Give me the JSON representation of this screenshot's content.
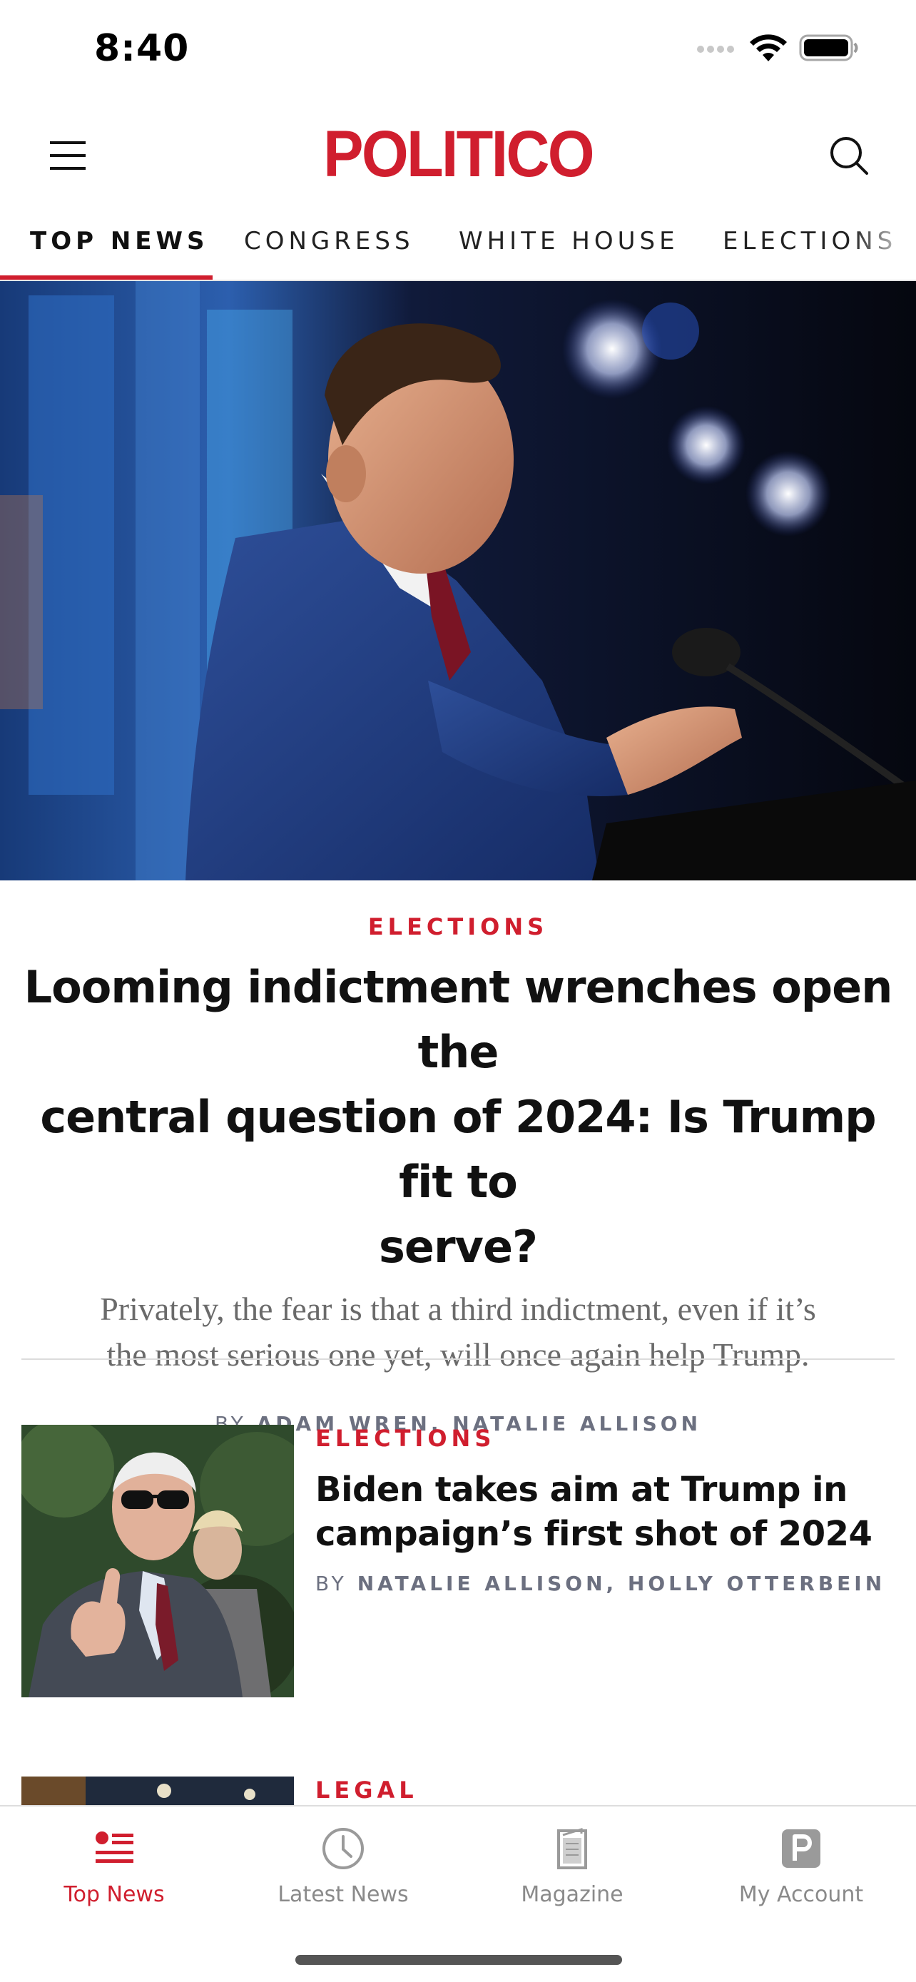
{
  "status_bar": {
    "time": "8:40",
    "icons": [
      "cellular-signal-icon",
      "wifi-icon",
      "battery-icon"
    ]
  },
  "header": {
    "logo": "POLITICO",
    "menu_icon": "hamburger-menu-icon",
    "search_icon": "search-icon"
  },
  "tabs": [
    {
      "label": "TOP NEWS",
      "active": true
    },
    {
      "label": "CONGRESS",
      "active": false
    },
    {
      "label": "WHITE HOUSE",
      "active": false
    },
    {
      "label": "ELECTIONS",
      "active": false
    }
  ],
  "hero": {
    "kicker": "ELECTIONS",
    "headline_lines": [
      "Looming indictment wrenches open the",
      "central question of 2024: Is Trump fit to",
      "serve?"
    ],
    "dek_lines": [
      "Privately, the fear is that a third indictment, even if it’s",
      "the most serious one yet, will once again help Trump."
    ],
    "byline_prefix": "BY",
    "byline_names": "ADAM WREN, NATALIE ALLISON"
  },
  "stories": [
    {
      "kicker": "ELECTIONS",
      "headline_lines": [
        "Biden takes aim at Trump in",
        "campaign’s first shot of 2024"
      ],
      "byline_prefix": "BY",
      "byline_names": "NATALIE ALLISON, HOLLY OTTERBEIN"
    },
    {
      "kicker": "LEGAL"
    }
  ],
  "bottom_nav": [
    {
      "label": "Top News",
      "icon": "top-news-icon",
      "active": true
    },
    {
      "label": "Latest News",
      "icon": "clock-icon",
      "active": false
    },
    {
      "label": "Magazine",
      "icon": "magazine-icon",
      "active": false
    },
    {
      "label": "My Account",
      "icon": "account-icon",
      "active": false
    }
  ],
  "colors": {
    "brand_red": "#d01e2e",
    "byline_gray": "#6c7080",
    "dek_gray": "#6a6a6a",
    "inactive_nav": "#8a8a8a"
  }
}
